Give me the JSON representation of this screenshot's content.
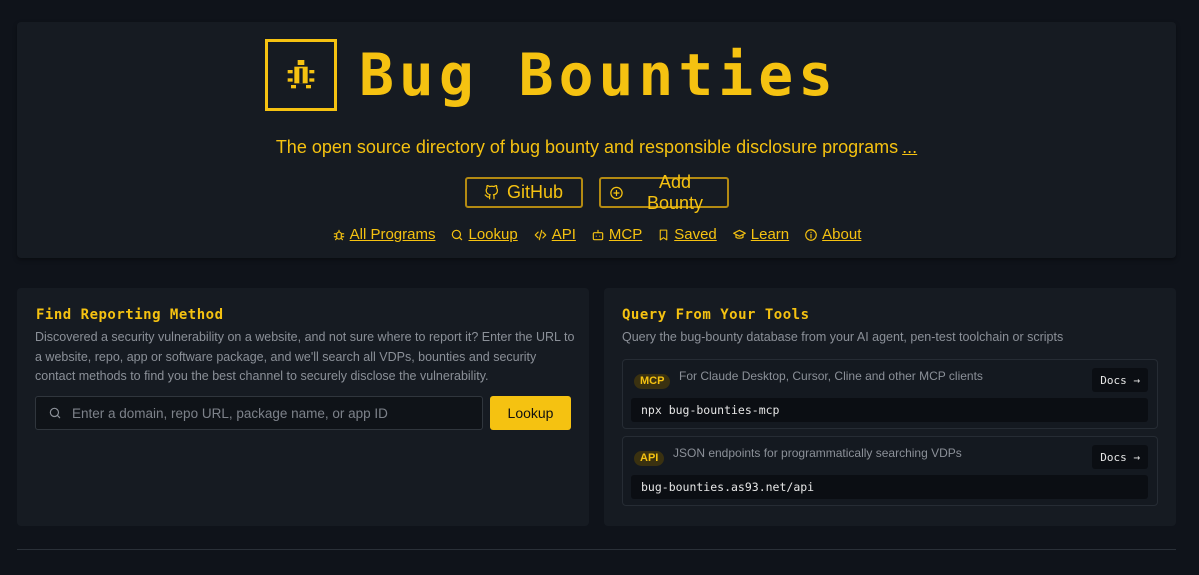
{
  "hero": {
    "title": "Bug Bounties",
    "tagline": "The open source directory of bug bounty and responsible disclosure programs",
    "tagline_more": "...",
    "buttons": {
      "github": "GitHub",
      "add_bounty": "Add Bounty"
    },
    "nav": [
      {
        "label": "All Programs",
        "icon": "bug-icon"
      },
      {
        "label": "Lookup",
        "icon": "search-icon"
      },
      {
        "label": "API",
        "icon": "code-icon"
      },
      {
        "label": "MCP",
        "icon": "robot-icon"
      },
      {
        "label": "Saved",
        "icon": "bookmark-icon"
      },
      {
        "label": "Learn",
        "icon": "graduation-cap-icon"
      },
      {
        "label": "About",
        "icon": "info-icon"
      }
    ]
  },
  "find": {
    "title": "Find Reporting Method",
    "description": "Discovered a security vulnerability on a website, and not sure where to report it? Enter the URL to a website, repo, app or software package, and we'll search all VDPs, bounties and security contact methods to find you the best channel to securely disclose the vulnerability.",
    "search_placeholder": "Enter a domain, repo URL, package name, or app ID",
    "lookup_label": "Lookup"
  },
  "query": {
    "title": "Query From Your Tools",
    "description": "Query the bug-bounty database from your AI agent, pen-test toolchain or scripts",
    "tools": [
      {
        "badge": "MCP",
        "description": "For Claude Desktop, Cursor, Cline and other MCP clients",
        "docs_label": "Docs →",
        "command": "npx bug-bounties-mcp"
      },
      {
        "badge": "API",
        "description": "JSON endpoints for programmatically searching VDPs",
        "docs_label": "Docs →",
        "command": "bug-bounties.as93.net/api"
      }
    ]
  },
  "colors": {
    "accent": "#f5c211",
    "background": "#0f131a",
    "card": "#161b22"
  }
}
